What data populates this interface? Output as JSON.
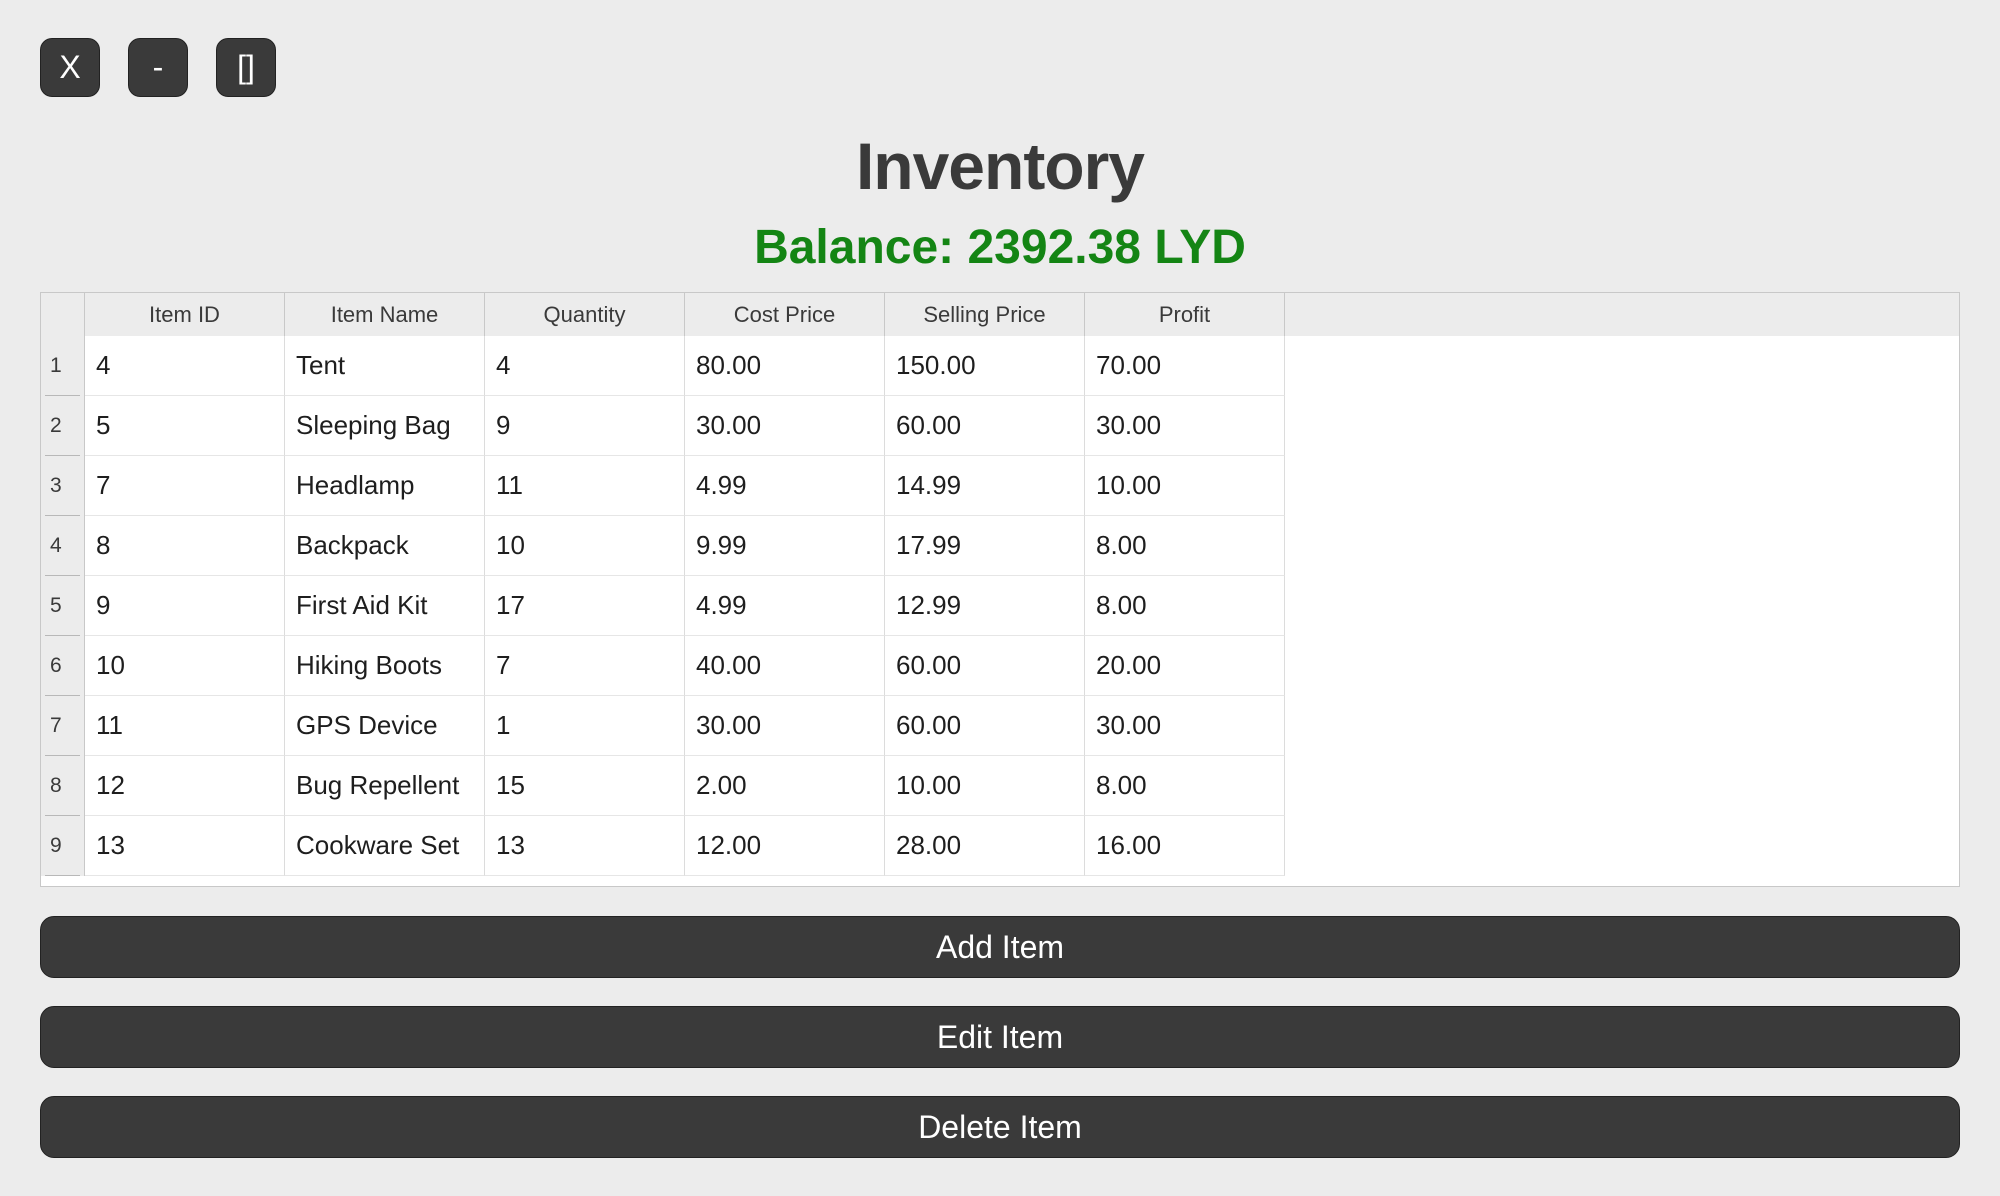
{
  "window_controls": {
    "close_label": "X",
    "minimize_label": "-",
    "maximize_label": "[]"
  },
  "title": "Inventory",
  "balance": "Balance: 2392.38 LYD",
  "colors": {
    "background": "#ececec",
    "button": "#3a3a3a",
    "balance_text": "#148514",
    "title_text": "#3a3a3a"
  },
  "table": {
    "columns": [
      "Item ID",
      "Item Name",
      "Quantity",
      "Cost Price",
      "Selling Price",
      "Profit"
    ],
    "rows": [
      {
        "num": "1",
        "cells": [
          "4",
          "Tent",
          "4",
          "80.00",
          "150.00",
          "70.00"
        ]
      },
      {
        "num": "2",
        "cells": [
          "5",
          "Sleeping Bag",
          "9",
          "30.00",
          "60.00",
          "30.00"
        ]
      },
      {
        "num": "3",
        "cells": [
          "7",
          "Headlamp",
          "11",
          "4.99",
          "14.99",
          "10.00"
        ]
      },
      {
        "num": "4",
        "cells": [
          "8",
          "Backpack",
          "10",
          "9.99",
          "17.99",
          "8.00"
        ]
      },
      {
        "num": "5",
        "cells": [
          "9",
          "First Aid Kit",
          "17",
          "4.99",
          "12.99",
          "8.00"
        ]
      },
      {
        "num": "6",
        "cells": [
          "10",
          "Hiking Boots",
          "7",
          "40.00",
          "60.00",
          "20.00"
        ]
      },
      {
        "num": "7",
        "cells": [
          "11",
          "GPS Device",
          "1",
          "30.00",
          "60.00",
          "30.00"
        ]
      },
      {
        "num": "8",
        "cells": [
          "12",
          "Bug Repellent",
          "15",
          "2.00",
          "10.00",
          "8.00"
        ]
      },
      {
        "num": "9",
        "cells": [
          "13",
          "Cookware Set",
          "13",
          "12.00",
          "28.00",
          "16.00"
        ]
      }
    ]
  },
  "actions": {
    "add_label": "Add Item",
    "edit_label": "Edit Item",
    "delete_label": "Delete Item"
  }
}
